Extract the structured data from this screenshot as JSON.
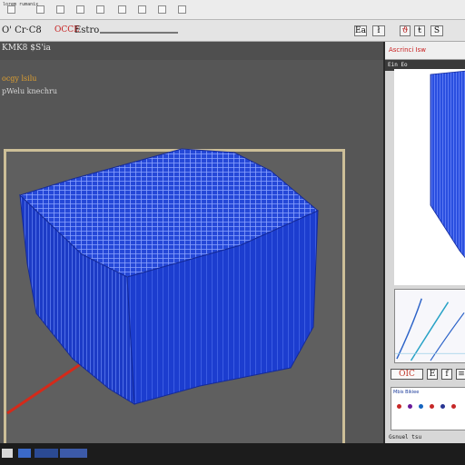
{
  "menubar": {
    "title": "lorem rumanix",
    "tool_count": 9
  },
  "toolbar": {
    "left_label": "O' Cr·C8",
    "mid_label": "OCCE",
    "right_label": "Estro",
    "buttons": [
      "Ea",
      "ł",
      "ϑ",
      "ŧ",
      "S"
    ]
  },
  "viewport": {
    "line1": "KMK8 $S'ia",
    "line2": "ocgy lsilu",
    "line3": "pWelu knechru"
  },
  "right_panel": {
    "title": "Ascrinci Isw",
    "sub": "Ein Eo",
    "buttons": [
      "OIC",
      "E",
      "f",
      "≡"
    ],
    "props_tabs": "Mbis  Bikiee",
    "status": "Gsnuel tsu"
  },
  "colors": {
    "mesh_blue": "#1f3fcf",
    "mesh_dark": "#142a9a",
    "axis_red": "#d42a1a",
    "frame": "#cdbf98"
  }
}
